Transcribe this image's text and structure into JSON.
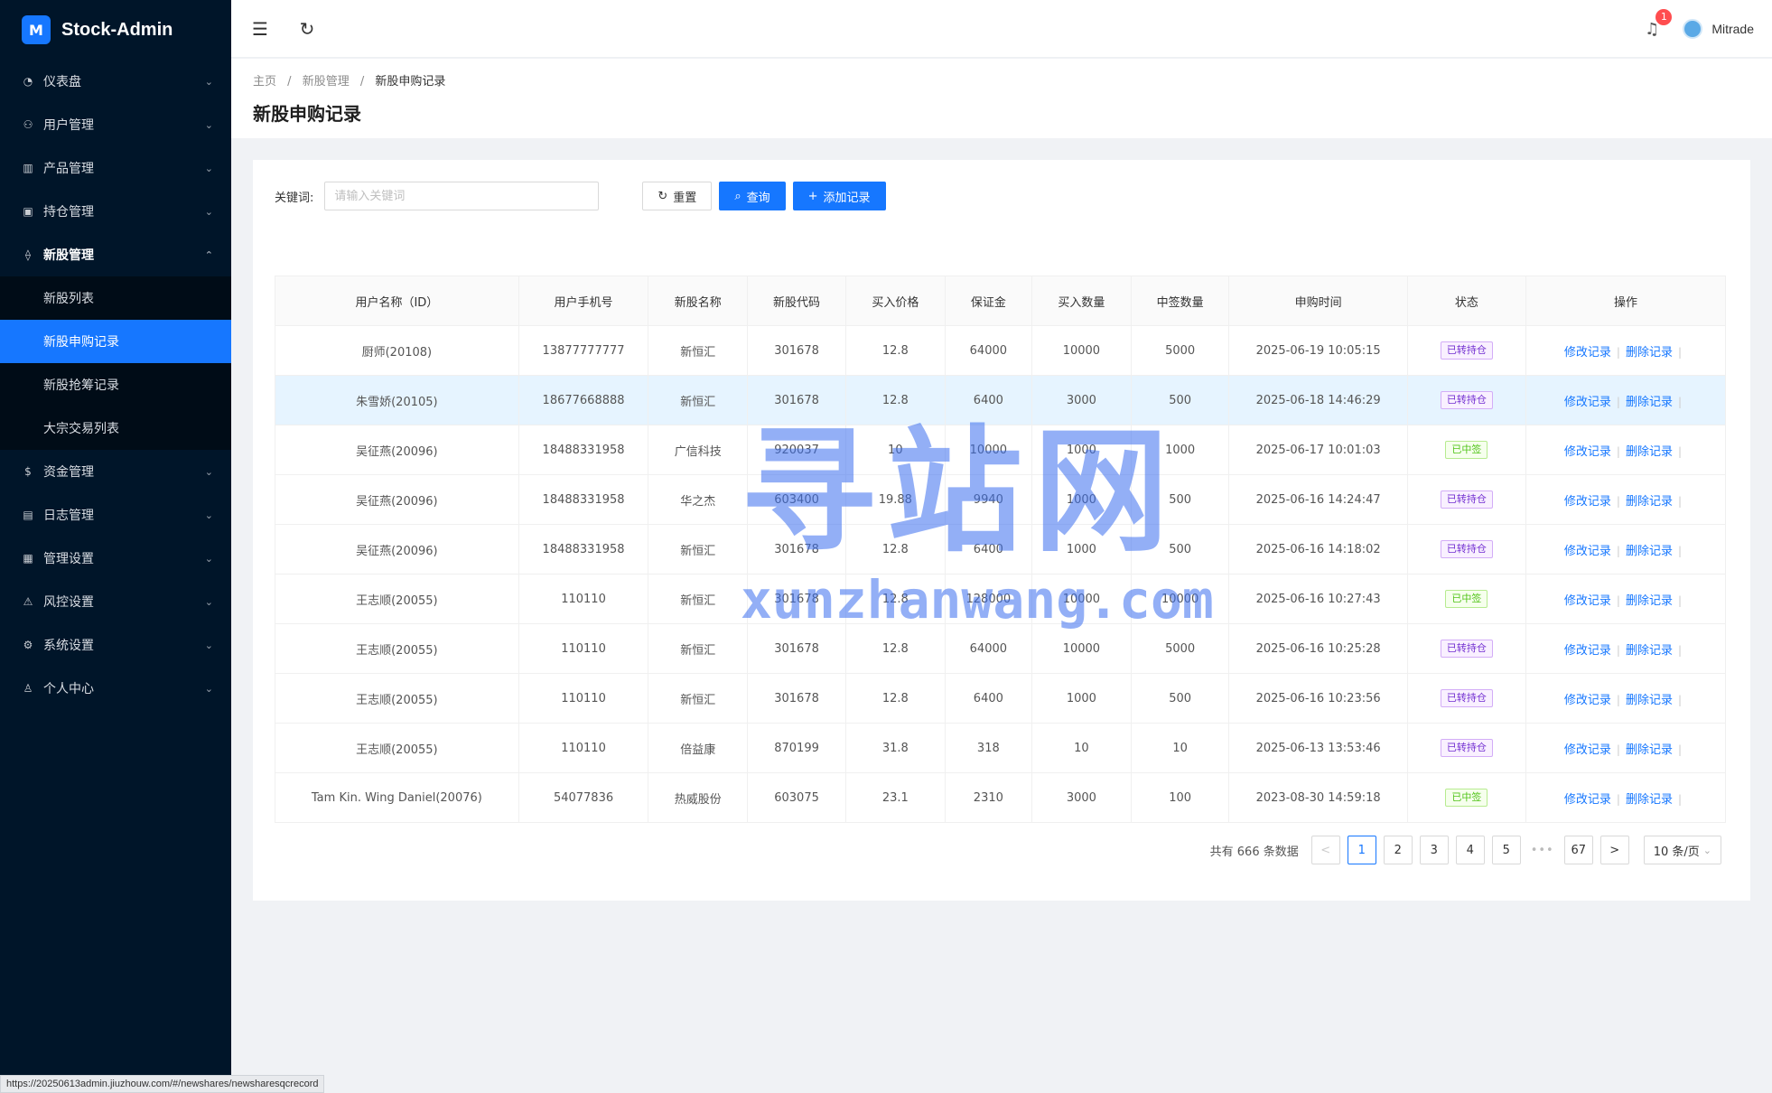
{
  "app": {
    "logo_glyph": "M",
    "title": "Stock-Admin"
  },
  "sidebar": {
    "items": [
      {
        "icon": "dashboard-icon",
        "glyph": "◔",
        "label": "仪表盘",
        "arrow": "⌄"
      },
      {
        "icon": "users-icon",
        "glyph": "⚇",
        "label": "用户管理",
        "arrow": "⌄"
      },
      {
        "icon": "bar-chart-icon",
        "glyph": "▥",
        "label": "产品管理",
        "arrow": "⌄"
      },
      {
        "icon": "ledger-icon",
        "glyph": "▣",
        "label": "持仓管理",
        "arrow": "⌄"
      },
      {
        "icon": "new-shares-icon",
        "glyph": "⟠",
        "label": "新股管理",
        "arrow": "⌃"
      }
    ],
    "submenu": [
      "新股列表",
      "新股申购记录",
      "新股抢筹记录",
      "大宗交易列表"
    ],
    "items_after": [
      {
        "icon": "money-icon",
        "glyph": "$",
        "label": "资金管理",
        "arrow": "⌄"
      },
      {
        "icon": "log-icon",
        "glyph": "▤",
        "label": "日志管理",
        "arrow": "⌄"
      },
      {
        "icon": "admin-settings-icon",
        "glyph": "▦",
        "label": "管理设置",
        "arrow": "⌄"
      },
      {
        "icon": "warning-icon",
        "glyph": "⚠",
        "label": "风控设置",
        "arrow": "⌄"
      },
      {
        "icon": "gear-icon",
        "glyph": "⚙",
        "label": "系统设置",
        "arrow": "⌄"
      },
      {
        "icon": "person-icon",
        "glyph": "♙",
        "label": "个人中心",
        "arrow": "⌄"
      }
    ]
  },
  "header": {
    "menu_glyph": "☰",
    "refresh_glyph": "↻",
    "bell_glyph": "♫",
    "notification_count": "1",
    "user_name": "Mitrade"
  },
  "breadcrumb": [
    "主页",
    "新股管理",
    "新股申购记录"
  ],
  "breadcrumb_sep": "/",
  "page_title": "新股申购记录",
  "search": {
    "label": "关键词:",
    "placeholder": "请输入关键词",
    "value": ""
  },
  "buttons": {
    "reset_icon": "↻",
    "reset": "重置",
    "query_icon": "⌕",
    "query": "查询",
    "add_icon": "+",
    "add": "添加记录"
  },
  "table": {
    "columns": [
      "用户名称（ID）",
      "用户手机号",
      "新股名称",
      "新股代码",
      "买入价格",
      "保证金",
      "买入数量",
      "中签数量",
      "申购时间",
      "状态",
      "操作"
    ],
    "rows": [
      {
        "user": "厨师(20108)",
        "phone": "13877777777",
        "name": "新恒汇",
        "code": "301678",
        "price": "12.8",
        "margin": "64000",
        "qty": "10000",
        "won": "5000",
        "time": "2025-06-19 10:05:15",
        "status": "已转持仓",
        "status_color": "purple"
      },
      {
        "user": "朱雪娇(20105)",
        "phone": "18677668888",
        "name": "新恒汇",
        "code": "301678",
        "price": "12.8",
        "margin": "6400",
        "qty": "3000",
        "won": "500",
        "time": "2025-06-18 14:46:29",
        "status": "已转持仓",
        "status_color": "purple"
      },
      {
        "user": "吴征燕(20096)",
        "phone": "18488331958",
        "name": "广信科技",
        "code": "920037",
        "price": "10",
        "margin": "10000",
        "qty": "1000",
        "won": "1000",
        "time": "2025-06-17 10:01:03",
        "status": "已中签",
        "status_color": "green"
      },
      {
        "user": "吴征燕(20096)",
        "phone": "18488331958",
        "name": "华之杰",
        "code": "603400",
        "price": "19.88",
        "margin": "9940",
        "qty": "1000",
        "won": "500",
        "time": "2025-06-16 14:24:47",
        "status": "已转持仓",
        "status_color": "purple"
      },
      {
        "user": "吴征燕(20096)",
        "phone": "18488331958",
        "name": "新恒汇",
        "code": "301678",
        "price": "12.8",
        "margin": "6400",
        "qty": "1000",
        "won": "500",
        "time": "2025-06-16 14:18:02",
        "status": "已转持仓",
        "status_color": "purple"
      },
      {
        "user": "王志顺(20055)",
        "phone": "110110",
        "name": "新恒汇",
        "code": "301678",
        "price": "12.8",
        "margin": "128000",
        "qty": "10000",
        "won": "10000",
        "time": "2025-06-16 10:27:43",
        "status": "已中签",
        "status_color": "green"
      },
      {
        "user": "王志顺(20055)",
        "phone": "110110",
        "name": "新恒汇",
        "code": "301678",
        "price": "12.8",
        "margin": "64000",
        "qty": "10000",
        "won": "5000",
        "time": "2025-06-16 10:25:28",
        "status": "已转持仓",
        "status_color": "purple"
      },
      {
        "user": "王志顺(20055)",
        "phone": "110110",
        "name": "新恒汇",
        "code": "301678",
        "price": "12.8",
        "margin": "6400",
        "qty": "1000",
        "won": "500",
        "time": "2025-06-16 10:23:56",
        "status": "已转持仓",
        "status_color": "purple"
      },
      {
        "user": "王志顺(20055)",
        "phone": "110110",
        "name": "倍益康",
        "code": "870199",
        "price": "31.8",
        "margin": "318",
        "qty": "10",
        "won": "10",
        "time": "2025-06-13 13:53:46",
        "status": "已转持仓",
        "status_color": "purple"
      },
      {
        "user": "Tam Kin. Wing Daniel(20076)",
        "phone": "54077836",
        "name": "热威股份",
        "code": "603075",
        "price": "23.1",
        "margin": "2310",
        "qty": "3000",
        "won": "100",
        "time": "2023-08-30 14:59:18",
        "status": "已中签",
        "status_color": "green"
      }
    ],
    "actions": {
      "edit": "修改记录",
      "delete": "删除记录",
      "sep": "|"
    },
    "highlighted_row": 1
  },
  "pagination": {
    "total": "共有 666 条数据",
    "prev": "<",
    "next": ">",
    "pages": [
      "1",
      "2",
      "3",
      "4",
      "5"
    ],
    "ellipsis": "•••",
    "last": "67",
    "current": "1",
    "page_size": "10 条/页",
    "page_size_chevron": "⌄"
  },
  "watermark": {
    "cn": "寻站网",
    "en": "xunzhanwang.com"
  },
  "status_url": "https://20250613admin.jiuzhouw.com/#/newshares/newsharesqcrecord",
  "colors": {
    "sidebar_bg": "#001529",
    "primary": "#1677ff",
    "tag_purple": "#722ed1",
    "tag_green": "#52c41a",
    "badge": "#ff4d4f"
  }
}
